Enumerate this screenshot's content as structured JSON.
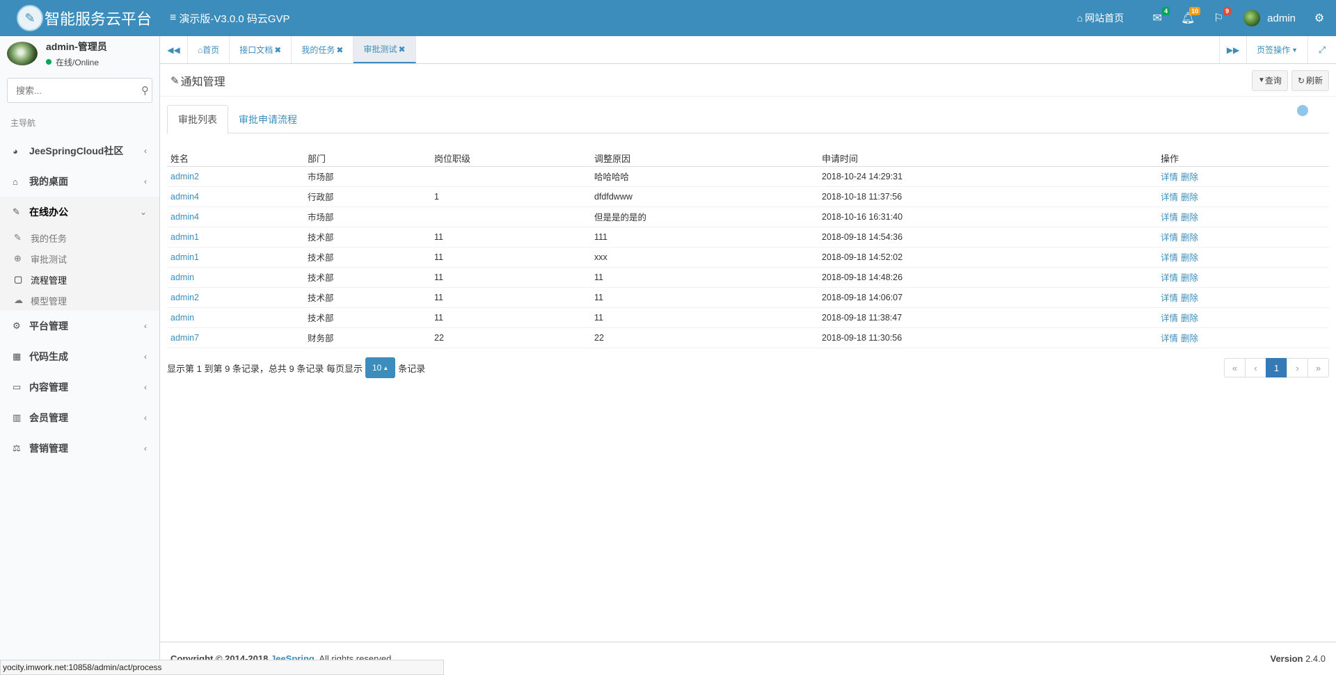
{
  "header": {
    "logo_text": "智能服务云平台",
    "title": "演示版-V3.0.0 码云GVP",
    "site_home": "网站首页",
    "mail_count": "4",
    "notify_count": "10",
    "flag_count": "9",
    "username": "admin"
  },
  "sidebar": {
    "user_name": "admin-管理员",
    "user_status": "在线/Online",
    "search_placeholder": "搜索...",
    "nav_header": "主导航",
    "items": [
      {
        "label": "JeeSpringCloud社区"
      },
      {
        "label": "我的桌面"
      },
      {
        "label": "在线办公"
      },
      {
        "label": "平台管理"
      },
      {
        "label": "代码生成"
      },
      {
        "label": "内容管理"
      },
      {
        "label": "会员管理"
      },
      {
        "label": "营销管理"
      }
    ],
    "sub_items": [
      {
        "label": "我的任务"
      },
      {
        "label": "审批测试"
      },
      {
        "label": "流程管理"
      },
      {
        "label": "模型管理"
      }
    ]
  },
  "tabsbar": {
    "tabs": [
      {
        "label": "首页"
      },
      {
        "label": "接口文档"
      },
      {
        "label": "我的任务"
      },
      {
        "label": "审批测试"
      }
    ],
    "page_actions": "页签操作"
  },
  "content": {
    "title": "通知管理",
    "query_btn": "查询",
    "refresh_btn": "刷新",
    "tabs": [
      {
        "label": "审批列表"
      },
      {
        "label": "审批申请流程"
      }
    ],
    "columns": [
      "姓名",
      "部门",
      "岗位职级",
      "调整原因",
      "申请时间",
      "操作"
    ],
    "rows": [
      {
        "name": "admin2",
        "dept": "市场部",
        "level": "",
        "reason": "哈哈哈哈",
        "time": "2018-10-24 14:29:31"
      },
      {
        "name": "admin4",
        "dept": "行政部",
        "level": "1",
        "reason": "dfdfdwww",
        "time": "2018-10-18 11:37:56"
      },
      {
        "name": "admin4",
        "dept": "市场部",
        "level": "",
        "reason": "但是是的是的",
        "time": "2018-10-16 16:31:40"
      },
      {
        "name": "admin1",
        "dept": "技术部",
        "level": "11",
        "reason": "111",
        "time": "2018-09-18 14:54:36"
      },
      {
        "name": "admin1",
        "dept": "技术部",
        "level": "11",
        "reason": "xxx",
        "time": "2018-09-18 14:52:02"
      },
      {
        "name": "admin",
        "dept": "技术部",
        "level": "11",
        "reason": "11",
        "time": "2018-09-18 14:48:26"
      },
      {
        "name": "admin2",
        "dept": "技术部",
        "level": "11",
        "reason": "11",
        "time": "2018-09-18 14:06:07"
      },
      {
        "name": "admin",
        "dept": "技术部",
        "level": "11",
        "reason": "11",
        "time": "2018-09-18 11:38:47"
      },
      {
        "name": "admin7",
        "dept": "财务部",
        "level": "22",
        "reason": "22",
        "time": "2018-09-18 11:30:56"
      }
    ],
    "op_detail": "详情",
    "op_delete": "删除",
    "pager_text": "显示第 1 到第 9 条记录，总共 9 条记录 每页显示",
    "page_size": "10",
    "pager_suffix": "条记录",
    "current_page": "1"
  },
  "footer": {
    "copyright_prefix": "Copyright © 2014-2018",
    "copyright_link": "JeeSpring",
    "copyright_suffix": ". All rights reserved.",
    "version_label": "Version",
    "version": "2.4.0"
  },
  "statusbar": {
    "url": "yocity.imwork.net:10858/admin/act/process"
  },
  "colors": {
    "primary": "#3c8dbc",
    "success": "#00a65a",
    "warning": "#f39c12",
    "danger": "#dd4b39"
  }
}
